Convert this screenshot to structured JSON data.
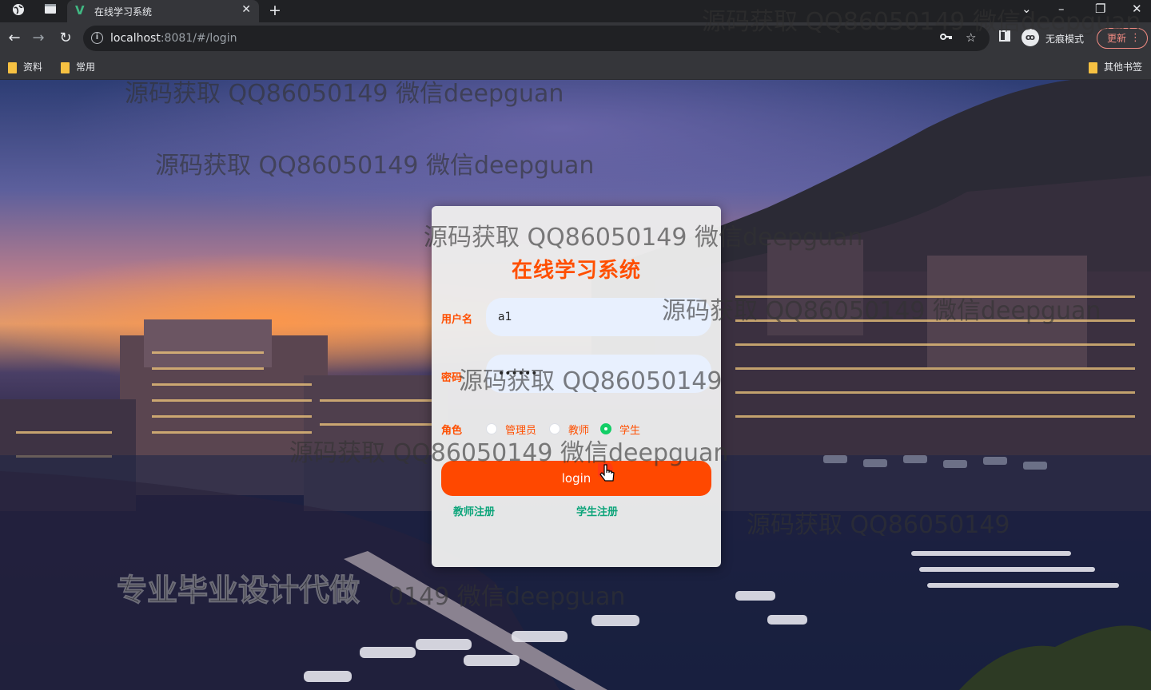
{
  "browser": {
    "tab_title": "在线学习系统",
    "url_host": "localhost",
    "url_path": ":8081/#/login",
    "incognito_label": "无痕模式",
    "update_label": "更新",
    "bookmarks": [
      "资料",
      "常用"
    ],
    "other_bookmarks": "其他书签"
  },
  "login": {
    "title": "在线学习系统",
    "username_label": "用户名",
    "username_value": "a1",
    "password_label": "密码",
    "password_value": "••••••",
    "role_label": "角色",
    "roles": [
      "管理员",
      "教师",
      "学生"
    ],
    "selected_role": "学生",
    "login_button": "login",
    "teacher_register": "教师注册",
    "student_register": "学生注册"
  },
  "watermarks": {
    "text": "源码获取 QQ86050149 微信deepguan",
    "partial": "源码获取 QQ86050149",
    "promo": "专业毕业设计代做",
    "promo_tail": "0149 微信deepguan"
  },
  "colors": {
    "accent": "#ff4f00",
    "button": "#ff4800",
    "link": "#0ea57b",
    "radio_checked": "#13ce66"
  }
}
